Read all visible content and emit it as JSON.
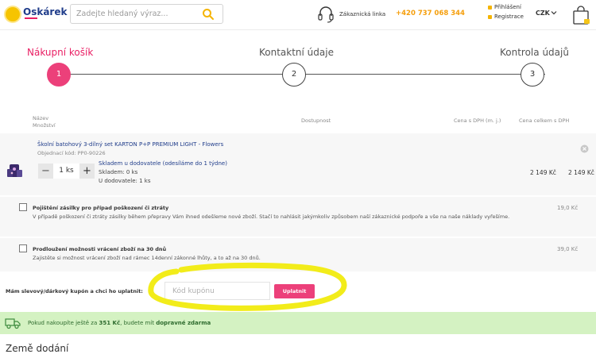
{
  "header": {
    "logo_text": "Oskárek",
    "search_placeholder": "Zadejte hledaný výraz...",
    "phone_label": "Zákaznická linka",
    "phone_number": "+420 737 068 344",
    "login": "Přihlášení",
    "register": "Registrace",
    "currency": "CZK"
  },
  "steps": [
    {
      "title": "Nákupní košík",
      "number": "1",
      "active": true
    },
    {
      "title": "Kontaktní údaje",
      "number": "2",
      "active": false
    },
    {
      "title": "Kontrola údajů",
      "number": "3",
      "active": false
    }
  ],
  "table_headers": {
    "name": "Název",
    "quantity": "Množství",
    "availability": "Dostupnost",
    "price": "Cena s DPH (m. j.)",
    "total": "Cena celkem s DPH"
  },
  "product": {
    "title": "Školní batohový 3-dílný set KARTON P+P PREMIUM LIGHT - Flowers",
    "code": "Objednací kód: PP0-90226",
    "qty_minus": "−",
    "quantity": "1 ks",
    "qty_plus": "+",
    "delivery": "Skladem u dodovatele (odesíláme do 1 týdne)",
    "stock": "Skladem: 0 ks",
    "supplier": "U dodovatele: 1 ks",
    "unit_price": "2 149 Kč",
    "total_price": "2 149 Kč"
  },
  "services": [
    {
      "title": "Pojištění zásilky pro případ poškození či ztráty",
      "description": "V případě poškození či ztráty zásilky během přepravy Vám ihned odešleme nové zboží. Stačí to nahlásit jakýmkoliv způsobem naší zákaznické podpoře a vše na naše náklady vyřešíme.",
      "price": "19,0 Kč"
    },
    {
      "title": "Prodloužení možnosti vrácení zboží na 30 dnů",
      "description": "Zajistěte si možnost vrácení zboží nad rámec 14denní zákonné lhůty, a to až na 30 dnů.",
      "price": "39,0 Kč"
    }
  ],
  "coupon": {
    "label": "Mám slevový/dárkový kupón a chci ho uplatnit:",
    "placeholder": "Kód kupónu",
    "button": "Uplatnit"
  },
  "free_shipping": {
    "prefix": "Pokud nakoupíte ještě za",
    "amount": "351 Kč",
    "middle": ", budete mít",
    "emphasis": "dopravné zdarma"
  },
  "country_title": "Země dodání",
  "colors": {
    "accent": "#ec407a",
    "brand": "#1f3c8a",
    "phone": "#f59e0b",
    "highlight": "#f2ec1a",
    "free_shipping_bg": "#d4f2c2"
  }
}
